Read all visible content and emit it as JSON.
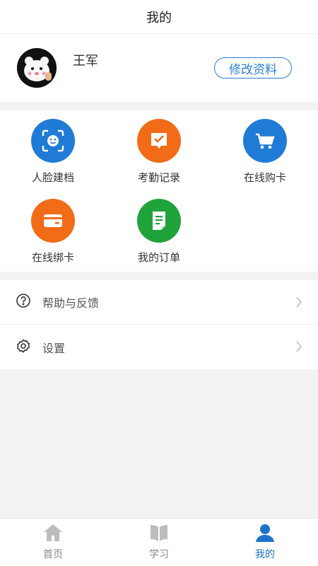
{
  "header": {
    "title": "我的"
  },
  "profile": {
    "name": "王军",
    "edit_label": "修改资料"
  },
  "features": [
    {
      "label": "人脸建档",
      "icon": "face-scan-icon",
      "color": "#1f7bd6"
    },
    {
      "label": "考勤记录",
      "icon": "attendance-check-icon",
      "color": "#f26b17"
    },
    {
      "label": "在线购卡",
      "icon": "shopping-cart-icon",
      "color": "#1f7bd6"
    },
    {
      "label": "在线绑卡",
      "icon": "bank-card-icon",
      "color": "#f26b17"
    },
    {
      "label": "我的订单",
      "icon": "order-document-icon",
      "color": "#21a33b"
    }
  ],
  "menu": [
    {
      "label": "帮助与反馈",
      "icon": "help-icon"
    },
    {
      "label": "设置",
      "icon": "settings-icon"
    }
  ],
  "tabs": [
    {
      "label": "首页",
      "icon": "home-icon",
      "active": false
    },
    {
      "label": "学习",
      "icon": "book-icon",
      "active": false
    },
    {
      "label": "我的",
      "icon": "user-icon",
      "active": true
    }
  ],
  "colors": {
    "accent": "#1e73c8",
    "orange": "#f26b17",
    "green": "#21a33b"
  }
}
